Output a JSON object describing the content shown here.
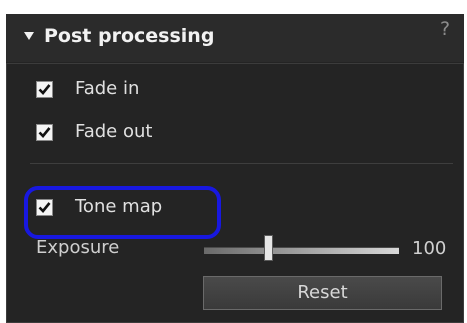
{
  "panel": {
    "title": "Post processing",
    "help_label": "?"
  },
  "options": [
    {
      "label": "Fade in",
      "checked": true
    },
    {
      "label": "Fade out",
      "checked": true
    },
    {
      "label": "Tone map",
      "checked": true
    }
  ],
  "exposure": {
    "label": "Exposure",
    "value": "100",
    "slider_level_fraction": 0.33
  },
  "reset": {
    "label": "Reset"
  },
  "colors": {
    "highlight": "#1818e0",
    "panel_bg": "#242424",
    "text": "#e0e0e0"
  },
  "icons": {
    "collapse": "triangle-down-icon",
    "checkmark": "checkmark-icon"
  }
}
